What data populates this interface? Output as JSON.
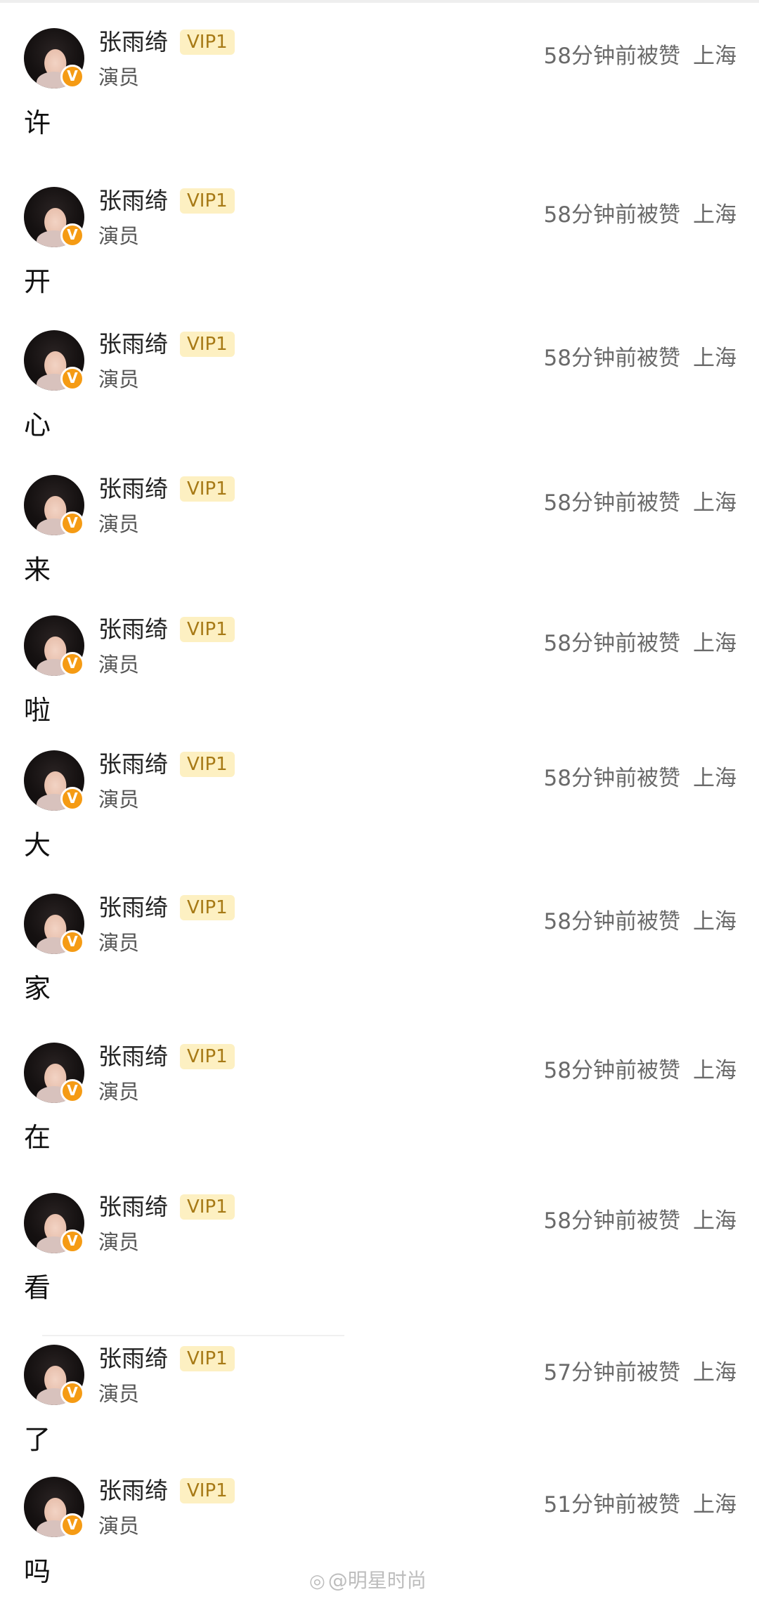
{
  "comments": [
    {
      "name": "张雨绮",
      "vip": "VIP1",
      "role": "演员",
      "time": "58分钟前被赞",
      "location": "上海",
      "text": "许"
    },
    {
      "name": "张雨绮",
      "vip": "VIP1",
      "role": "演员",
      "time": "58分钟前被赞",
      "location": "上海",
      "text": "开"
    },
    {
      "name": "张雨绮",
      "vip": "VIP1",
      "role": "演员",
      "time": "58分钟前被赞",
      "location": "上海",
      "text": "心"
    },
    {
      "name": "张雨绮",
      "vip": "VIP1",
      "role": "演员",
      "time": "58分钟前被赞",
      "location": "上海",
      "text": "来"
    },
    {
      "name": "张雨绮",
      "vip": "VIP1",
      "role": "演员",
      "time": "58分钟前被赞",
      "location": "上海",
      "text": "啦"
    },
    {
      "name": "张雨绮",
      "vip": "VIP1",
      "role": "演员",
      "time": "58分钟前被赞",
      "location": "上海",
      "text": "大"
    },
    {
      "name": "张雨绮",
      "vip": "VIP1",
      "role": "演员",
      "time": "58分钟前被赞",
      "location": "上海",
      "text": "家"
    },
    {
      "name": "张雨绮",
      "vip": "VIP1",
      "role": "演员",
      "time": "58分钟前被赞",
      "location": "上海",
      "text": "在"
    },
    {
      "name": "张雨绮",
      "vip": "VIP1",
      "role": "演员",
      "time": "58分钟前被赞",
      "location": "上海",
      "text": "看"
    },
    {
      "name": "张雨绮",
      "vip": "VIP1",
      "role": "演员",
      "time": "57分钟前被赞",
      "location": "上海",
      "text": "了"
    },
    {
      "name": "张雨绮",
      "vip": "VIP1",
      "role": "演员",
      "time": "51分钟前被赞",
      "location": "上海",
      "text": "吗"
    }
  ],
  "verified_badge_icon": "verified-v-icon",
  "colors": {
    "vip_bg": "#fdf0c2",
    "vip_text": "#a77a16",
    "badge": "#f59b14"
  },
  "watermark": {
    "icon": "weibo-icon",
    "text": "@明星时尚"
  }
}
